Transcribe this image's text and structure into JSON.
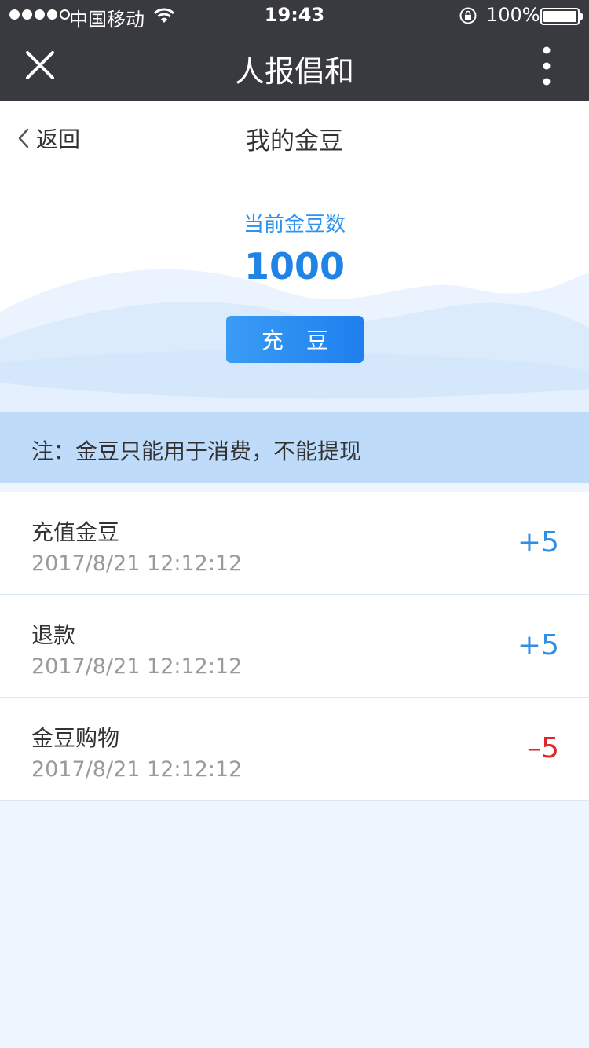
{
  "status_bar": {
    "carrier": "中国移动",
    "time": "19:43",
    "battery": "100%"
  },
  "nav": {
    "title": "人报倡和",
    "close_icon": "close-icon",
    "more_icon": "more-vertical-icon"
  },
  "subheader": {
    "back_label": "返回",
    "title": "我的金豆"
  },
  "balance": {
    "label": "当前金豆数",
    "value": "1000",
    "button_label": "充 豆"
  },
  "note": "注：金豆只能用于消费，不能提现",
  "transactions": [
    {
      "title": "充值金豆",
      "date": "2017/8/21 12:12:12",
      "amount": "+5",
      "sign": "positive"
    },
    {
      "title": "退款",
      "date": "2017/8/21 12:12:12",
      "amount": "+5",
      "sign": "positive"
    },
    {
      "title": "金豆购物",
      "date": "2017/8/21 12:12:12",
      "amount": "–5",
      "sign": "negative"
    }
  ],
  "colors": {
    "accent": "#1f84e6",
    "positive": "#2f8ee8",
    "negative": "#e0252a",
    "nav_bg": "#393a3f",
    "note_bg": "#bedcf9",
    "page_bg": "#eef5fe"
  }
}
